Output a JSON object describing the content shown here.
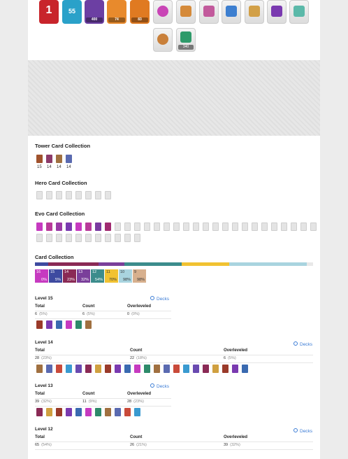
{
  "badges": {
    "level": "1",
    "exp_level": "55",
    "trophy_value": "400",
    "badge_74": "74",
    "badge_83": "83",
    "badge_340": "340",
    "colors": [
      "#c8242b",
      "#2aa1c9",
      "#6c3fa3",
      "#e88a2c",
      "#e07a21"
    ]
  },
  "sections": {
    "tower": "Tower Card Collection",
    "hero": "Hero Card Collection",
    "evo": "Evo Card Collection",
    "cards": "Card Collection"
  },
  "tower_levels": [
    "15",
    "14",
    "14",
    "14"
  ],
  "collection_bar": {
    "segments": [
      {
        "level": "16",
        "pct": "0%",
        "color": "#c63ac0"
      },
      {
        "level": "15",
        "pct": "5%",
        "color": "#3e4aa0"
      },
      {
        "level": "14",
        "pct": "23%",
        "color": "#8a2a55"
      },
      {
        "level": "13",
        "pct": "32%",
        "color": "#7a3f9a"
      },
      {
        "level": "12",
        "pct": "54%",
        "color": "#3c8c8c"
      },
      {
        "level": "11",
        "pct": "70%",
        "color": "#f1c232"
      },
      {
        "level": "10",
        "pct": "98%",
        "color": "#a9d4df"
      },
      {
        "level": "9",
        "pct": "98%",
        "color": "#d7b08e"
      }
    ]
  },
  "labels": {
    "total": "Total",
    "count": "Count",
    "overleveled": "Overleveled",
    "decks": "Decks"
  },
  "levels": [
    {
      "title": "Level 15",
      "total": "6",
      "total_pct": "(5%)",
      "count": "6",
      "count_pct": "(5%)",
      "over": "0",
      "over_pct": "(0%)"
    },
    {
      "title": "Level 14",
      "total": "28",
      "total_pct": "(23%)",
      "count": "22",
      "count_pct": "(18%)",
      "over": "6",
      "over_pct": "(5%)"
    },
    {
      "title": "Level 13",
      "total": "39",
      "total_pct": "(32%)",
      "count": "11",
      "count_pct": "(9%)",
      "over": "28",
      "over_pct": "(23%)"
    },
    {
      "title": "Level 12",
      "total": "65",
      "total_pct": "(54%)",
      "count": "26",
      "count_pct": "(21%)",
      "over": "39",
      "over_pct": "(32%)"
    }
  ]
}
